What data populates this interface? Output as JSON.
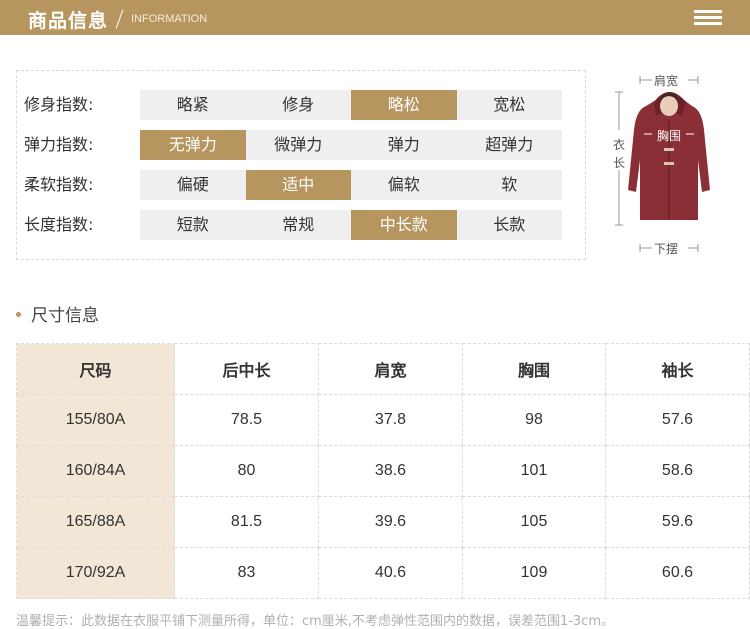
{
  "header": {
    "title_cn": "商品信息",
    "title_en": "INFORMATION",
    "menu_icon": "menu-icon"
  },
  "indices": [
    {
      "label": "修身指数:",
      "options": [
        "略紧",
        "修身",
        "略松",
        "宽松"
      ],
      "selected": 2
    },
    {
      "label": "弹力指数:",
      "options": [
        "无弹力",
        "微弹力",
        "弹力",
        "超弹力"
      ],
      "selected": 0
    },
    {
      "label": "柔软指数:",
      "options": [
        "偏硬",
        "适中",
        "偏软",
        "软"
      ],
      "selected": 1
    },
    {
      "label": "长度指数:",
      "options": [
        "短款",
        "常规",
        "中长款",
        "长款"
      ],
      "selected": 2
    }
  ],
  "diagram": {
    "shoulder": "肩宽",
    "length_1": "衣",
    "length_2": "长",
    "chest": "胸围",
    "hem": "下摆",
    "coat_color": "#8a2f35"
  },
  "size_section": {
    "title": "尺寸信息"
  },
  "size_table": {
    "headers": [
      "尺码",
      "后中长",
      "肩宽",
      "胸围",
      "袖长"
    ],
    "rows": [
      [
        "155/80A",
        "78.5",
        "37.8",
        "98",
        "57.6"
      ],
      [
        "160/84A",
        "80",
        "38.6",
        "101",
        "58.6"
      ],
      [
        "165/88A",
        "81.5",
        "39.6",
        "105",
        "59.6"
      ],
      [
        "170/92A",
        "83",
        "40.6",
        "109",
        "60.6"
      ]
    ]
  },
  "note": "温馨提示：此数据在衣服平铺下测量所得，单位：cm厘米,不考虑弹性范围内的数据，误差范围1-3cm。",
  "colors": {
    "accent": "#b6955e",
    "cell_bg": "#efefef",
    "size_col_bg": "#f2e7d7"
  }
}
